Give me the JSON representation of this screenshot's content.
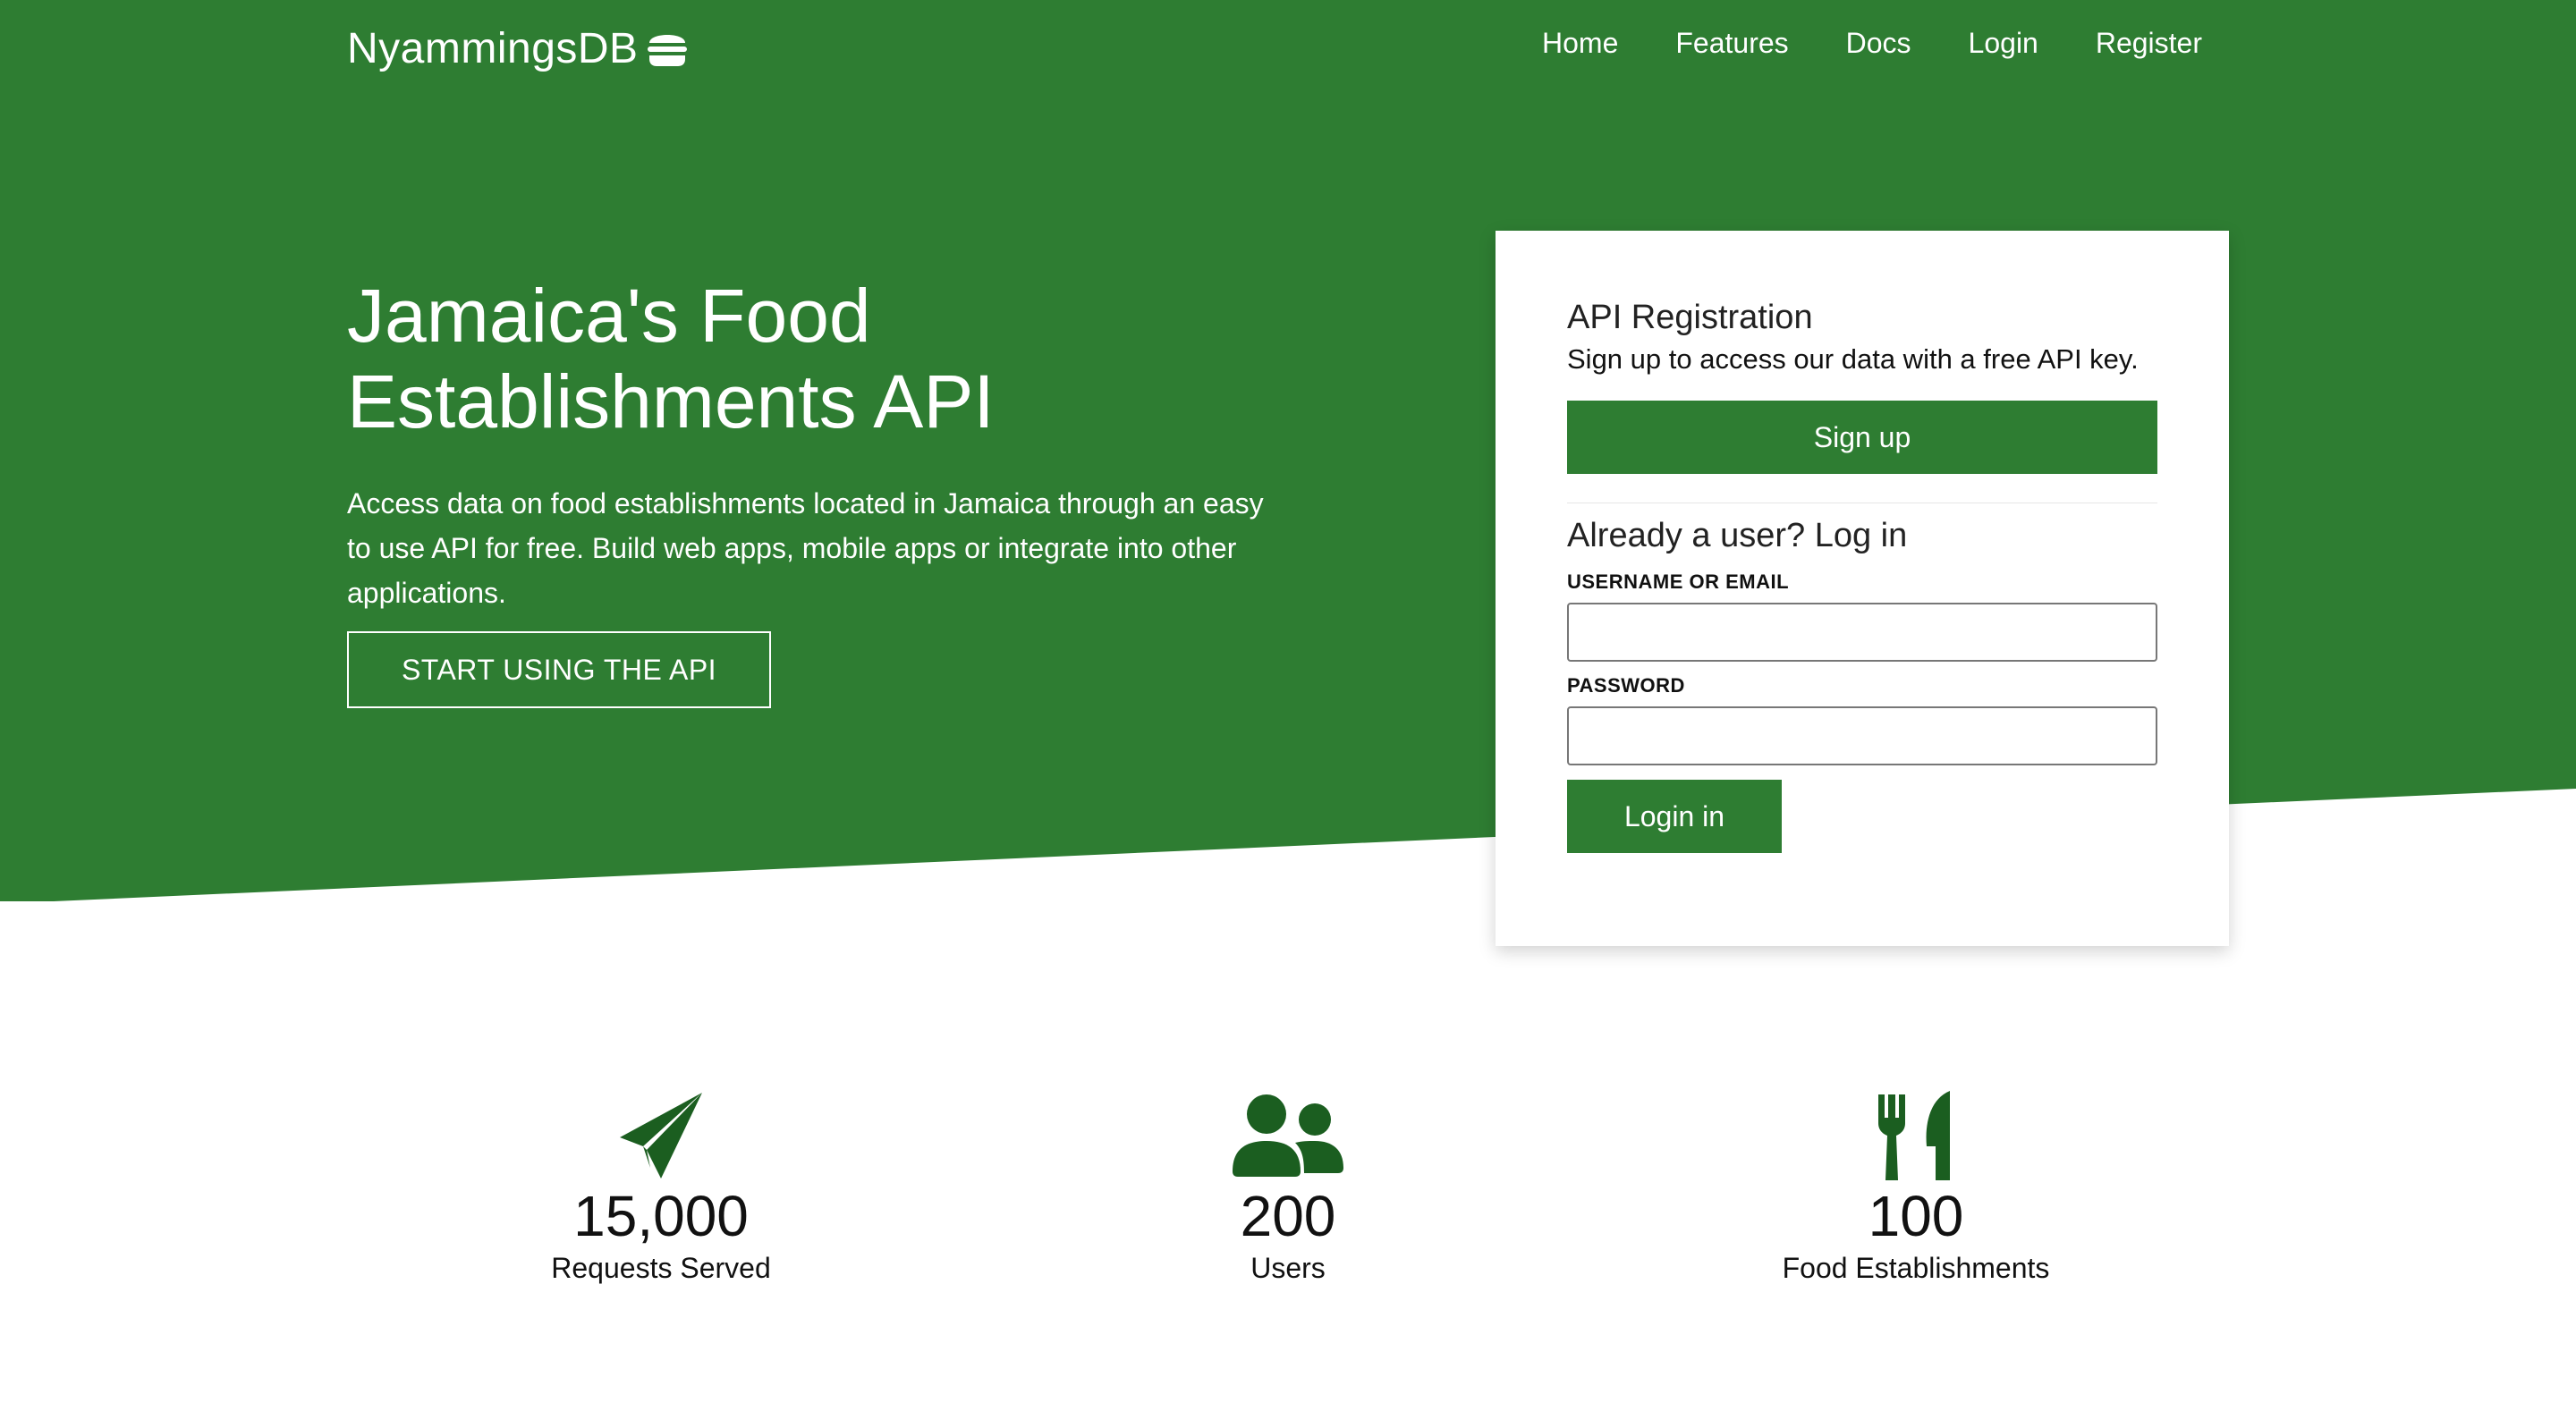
{
  "brand": {
    "name": "NyammingsDB",
    "icon": "burger-icon"
  },
  "nav": {
    "items": [
      {
        "label": "Home"
      },
      {
        "label": "Features"
      },
      {
        "label": "Docs"
      },
      {
        "label": "Login"
      },
      {
        "label": "Register"
      }
    ]
  },
  "hero": {
    "title_line1": "Jamaica's Food",
    "title_line2": "Establishments API",
    "description": "Access data on food establishments located in Jamaica through an easy to use API for free. Build web apps, mobile apps or integrate into other applications.",
    "cta_label": "START USING THE API"
  },
  "registration": {
    "title": "API Registration",
    "subtitle": "Sign up to access our data with a free API key.",
    "signup_label": "Sign up",
    "login_title": "Already a user? Log in",
    "username_label": "USERNAME OR EMAIL",
    "username_value": "",
    "password_label": "PASSWORD",
    "password_value": "",
    "login_label": "Login in"
  },
  "stats": [
    {
      "icon": "paper-plane-icon",
      "value": "15,000",
      "label": "Requests Served"
    },
    {
      "icon": "users-icon",
      "value": "200",
      "label": "Users"
    },
    {
      "icon": "utensils-icon",
      "value": "100",
      "label": "Food Establishments"
    }
  ],
  "colors": {
    "primary_green": "#2e7d32",
    "icon_green": "#1b5e20",
    "white": "#ffffff"
  }
}
